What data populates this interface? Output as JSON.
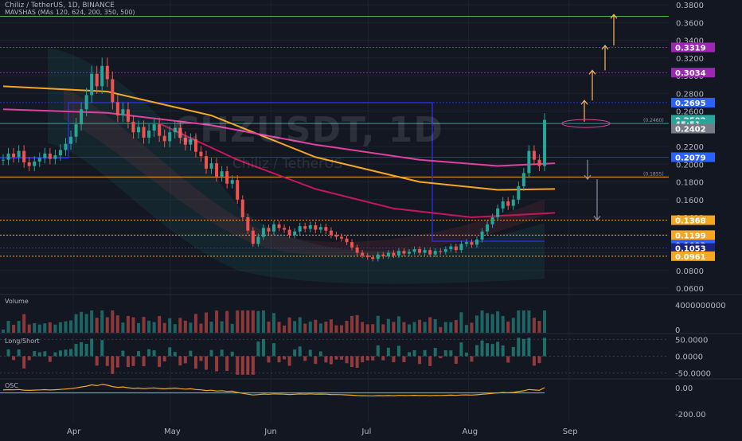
{
  "header": {
    "symbol_line": "Chiliz / TetherUS, 1D, BINANCE",
    "indicator_line": "MAVSHAS (MAs 120, 624, 200, 350, 500)"
  },
  "watermark": {
    "symbol": "CHZUSDT, 1D",
    "description": "Chiliz / TetherUS"
  },
  "colors": {
    "background": "#131722",
    "candle_up": "#26a69a",
    "candle_down": "#ef5350",
    "ma_orange": "#f5a623",
    "ma_magenta": "#e040a0",
    "ma_pink": "#c2185b",
    "box_blue": "#2a2fd8",
    "green_line": "#4caf50",
    "arrow_orange": "#ffb74d",
    "arrow_gray": "#8c8fa3"
  },
  "chart_data": [
    {
      "type": "candlestick",
      "name": "main",
      "title": "CHZUSDT, 1D",
      "y_axis": {
        "ylim": [
          0.058,
          0.382
        ],
        "ticks": [
          0.06,
          0.08,
          0.1,
          0.12,
          0.14,
          0.16,
          0.18,
          0.2,
          0.22,
          0.24,
          0.26,
          0.28,
          0.3,
          0.32,
          0.34,
          0.36,
          0.38
        ],
        "tick_labels": [
          "0.0600",
          "0.0800",
          "0.1000",
          "0.1200",
          "0.1400",
          "0.1600",
          "0.1800",
          "0.2000",
          "0.2200",
          "0.2400",
          "0.2600",
          "0.2800",
          "0.3000",
          "0.3200",
          "0.3400",
          "0.3600",
          "0.3800"
        ]
      },
      "x_axis": {
        "ticks": [
          "Apr",
          "May",
          "Jun",
          "Jul",
          "Aug",
          "Sep"
        ],
        "tick_dates": [
          "2021-04-01",
          "2021-05-01",
          "2021-06-01",
          "2021-07-01",
          "2021-08-01",
          "2021-09-01"
        ]
      },
      "close_series": [
        0.205,
        0.212,
        0.208,
        0.215,
        0.202,
        0.198,
        0.203,
        0.207,
        0.212,
        0.206,
        0.21,
        0.216,
        0.223,
        0.231,
        0.245,
        0.262,
        0.278,
        0.302,
        0.288,
        0.311,
        0.296,
        0.27,
        0.255,
        0.262,
        0.248,
        0.236,
        0.242,
        0.23,
        0.238,
        0.245,
        0.232,
        0.226,
        0.236,
        0.241,
        0.23,
        0.222,
        0.228,
        0.214,
        0.209,
        0.195,
        0.201,
        0.186,
        0.192,
        0.178,
        0.182,
        0.16,
        0.14,
        0.125,
        0.11,
        0.118,
        0.128,
        0.124,
        0.132,
        0.128,
        0.126,
        0.12,
        0.124,
        0.13,
        0.127,
        0.131,
        0.126,
        0.129,
        0.125,
        0.12,
        0.118,
        0.116,
        0.112,
        0.106,
        0.1,
        0.097,
        0.095,
        0.093,
        0.098,
        0.096,
        0.1,
        0.097,
        0.102,
        0.099,
        0.101,
        0.104,
        0.1,
        0.103,
        0.098,
        0.102,
        0.101,
        0.104,
        0.107,
        0.103,
        0.11,
        0.112,
        0.109,
        0.115,
        0.124,
        0.132,
        0.14,
        0.15,
        0.158,
        0.153,
        0.16,
        0.175,
        0.19,
        0.215,
        0.205,
        0.198,
        0.25
      ],
      "lines": [
        {
          "name": "",
          "color": "#f5a623",
          "x": [
            0,
            20,
            40,
            60,
            80,
            95,
            106
          ],
          "y": [
            0.288,
            0.282,
            0.255,
            0.208,
            0.18,
            0.171,
            0.172
          ]
        },
        {
          "name": "",
          "color": "#e040a0",
          "x": [
            0,
            20,
            40,
            60,
            80,
            95,
            106
          ],
          "y": [
            0.262,
            0.258,
            0.244,
            0.222,
            0.205,
            0.198,
            0.201
          ]
        },
        {
          "name": "",
          "color": "#c2185b",
          "x": [
            30,
            45,
            60,
            75,
            90,
            106
          ],
          "y": [
            0.246,
            0.205,
            0.172,
            0.15,
            0.14,
            0.145
          ]
        }
      ],
      "price_labels": [
        {
          "label": "0.3319",
          "value": 0.3319,
          "color": "#9c27b0"
        },
        {
          "label": "0.3034",
          "value": 0.3034,
          "color": "#9c27b0"
        },
        {
          "label": "0.2695",
          "value": 0.2695,
          "color": "#2962ff"
        },
        {
          "label": "0.2502",
          "value": 0.2502,
          "color": "#26a69a"
        },
        {
          "label": "45:51",
          "value": 0.2455,
          "color": "#26a69a"
        },
        {
          "label": "0.2402",
          "value": 0.2402,
          "color": "#787b86"
        },
        {
          "label": "0.2079",
          "value": 0.2079,
          "color": "#2962ff"
        },
        {
          "label": "0.1368",
          "value": 0.1368,
          "color": "#f5a623"
        },
        {
          "label": "0.1199",
          "value": 0.1199,
          "color": "#f5a623"
        },
        {
          "label": "0.1092",
          "value": 0.1092,
          "color": "#2962ff"
        },
        {
          "label": "0.1053",
          "value": 0.1053,
          "color": "#1a237e"
        },
        {
          "label": "0.0961",
          "value": 0.0961,
          "color": "#f5a623"
        }
      ],
      "annotations": [
        "(0.2460)",
        "(0.1855)"
      ]
    },
    {
      "type": "bar",
      "name": "volume",
      "title": "Volume",
      "y_axis": {
        "tick_labels": [
          "4000000000",
          "0"
        ],
        "ticks": [
          4000000000,
          0
        ]
      }
    },
    {
      "type": "line",
      "name": "long-short",
      "title": "Long/Short",
      "y_axis": {
        "tick_labels": [
          "50.0000",
          "0.0000",
          "-50.0000"
        ],
        "ticks": [
          50,
          0,
          -50
        ],
        "ylim": [
          -65,
          65
        ]
      }
    },
    {
      "type": "line",
      "name": "osc",
      "title": "OSC",
      "y_axis": {
        "tick_labels": [
          "0.00",
          "-200.00"
        ],
        "ticks": [
          0,
          -200
        ],
        "ylim": [
          -260,
          60
        ]
      }
    }
  ]
}
